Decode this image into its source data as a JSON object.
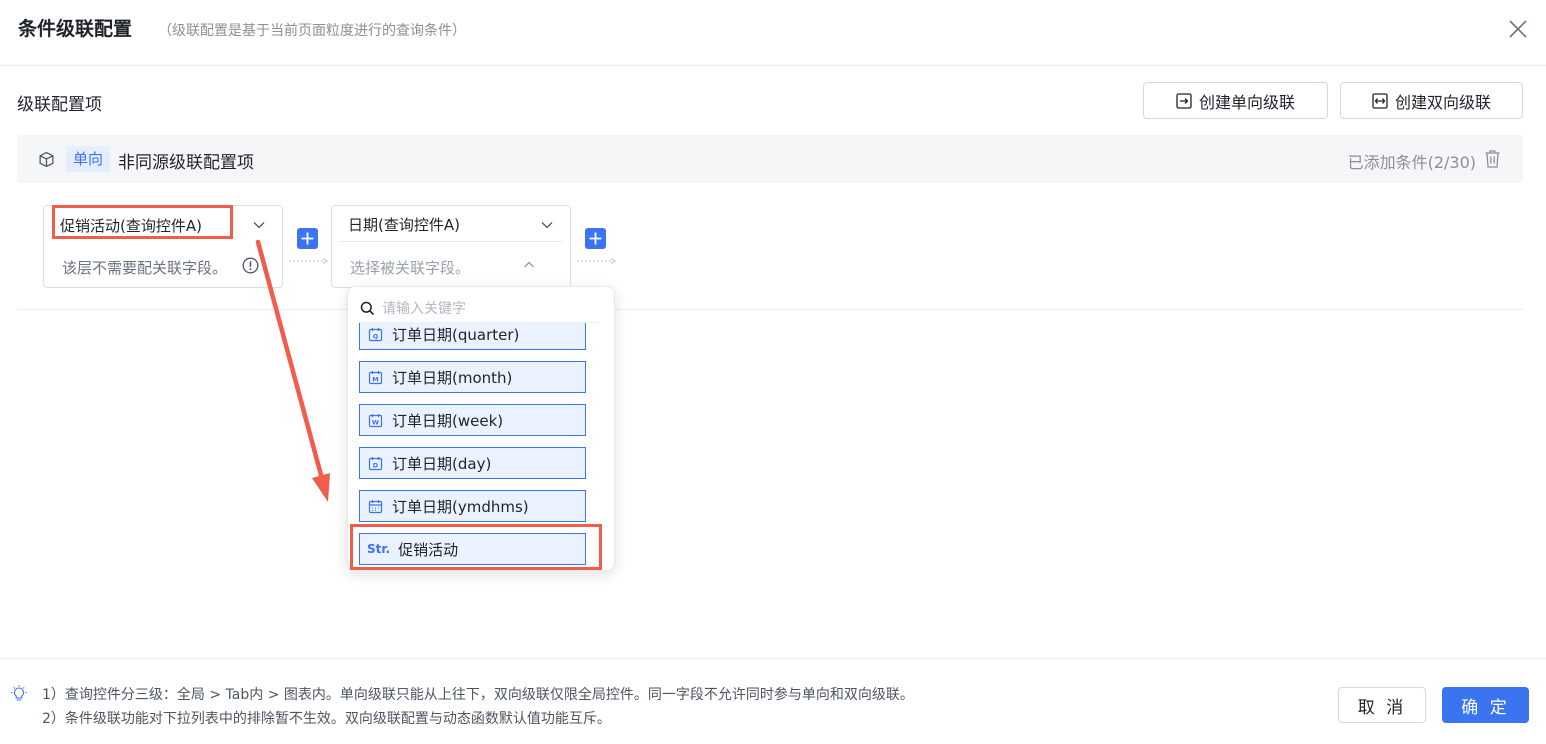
{
  "header": {
    "title": "条件级联配置",
    "subtitle": "（级联配置是基于当前页面粒度进行的查询条件）"
  },
  "section": {
    "title": "级联配置项",
    "create_unidirectional": "创建单向级联",
    "create_bidirectional": "创建双向级联"
  },
  "config_item": {
    "tag": "单向",
    "name": "非同源级联配置项",
    "count": "已添加条件(2/30)"
  },
  "nodes": [
    {
      "select": "促销活动(查询控件A)",
      "hint": "该层不需要配关联字段。"
    },
    {
      "select": "日期(查询控件A)",
      "hint": "选择被关联字段。"
    }
  ],
  "dropdown": {
    "search_placeholder": "请输入关键字",
    "items": [
      {
        "icon": "quarter-calendar-icon",
        "label": "订单日期(quarter)"
      },
      {
        "icon": "month-calendar-icon",
        "label": "订单日期(month)"
      },
      {
        "icon": "week-calendar-icon",
        "label": "订单日期(week)"
      },
      {
        "icon": "day-calendar-icon",
        "label": "订单日期(day)"
      },
      {
        "icon": "datetime-calendar-icon",
        "label": "订单日期(ymdhms)"
      },
      {
        "icon": "string-type-icon",
        "type_tag": "Str.",
        "label": "促销活动"
      }
    ]
  },
  "footer": {
    "note1": "1）查询控件分三级：全局 > Tab内 > 图表内。单向级联只能从上往下，双向级联仅限全局控件。同一字段不允许同时参与单向和双向级联。",
    "note2": "2）条件级联功能对下拉列表中的排除暂不生效。双向级联配置与动态函数默认值功能互斥。",
    "cancel": "取 消",
    "confirm": "确 定"
  },
  "colors": {
    "primary": "#3a74f0",
    "highlight": "#f25c4a",
    "tag_bg": "#e5eeff",
    "item_bg": "#eaf1ff"
  }
}
